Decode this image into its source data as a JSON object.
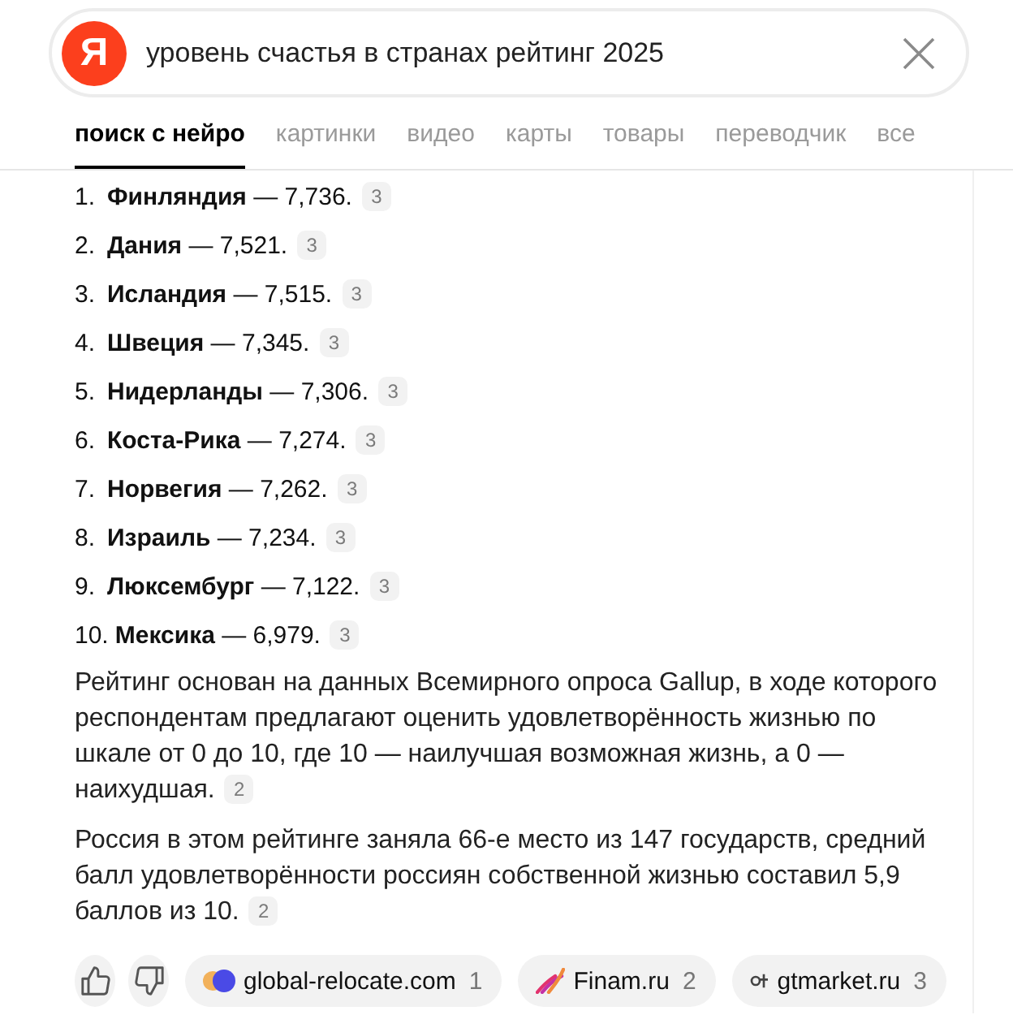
{
  "search": {
    "logo": "Я",
    "query": "уровень счастья в странах рейтинг 2025"
  },
  "tabs": [
    {
      "label": "поиск с нейро",
      "selected": true
    },
    {
      "label": "картинки",
      "selected": false
    },
    {
      "label": "видео",
      "selected": false
    },
    {
      "label": "карты",
      "selected": false
    },
    {
      "label": "товары",
      "selected": false
    },
    {
      "label": "переводчик",
      "selected": false
    },
    {
      "label": "все",
      "selected": false
    }
  ],
  "answer": {
    "list": [
      {
        "number": "1.",
        "text": "**Финляндия** — 7,736.",
        "citation": "3"
      },
      {
        "number": "2.",
        "text": "**Дания** — 7,521.",
        "citation": "3"
      },
      {
        "number": "3.",
        "text": "**Исландия** — 7,515.",
        "citation": "3"
      },
      {
        "number": "4.",
        "text": "**Швеция** — 7,345.",
        "citation": "3"
      },
      {
        "number": "5.",
        "text": "**Нидерланды** — 7,306.",
        "citation": "3"
      },
      {
        "number": "6.",
        "text": "**Коста-Рика** — 7,274.",
        "citation": "3"
      },
      {
        "number": "7.",
        "text": "**Норвегия** — 7,262.",
        "citation": "3"
      },
      {
        "number": "8.",
        "text": "**Израиль** — 7,234.",
        "citation": "3"
      },
      {
        "number": "9.",
        "text": "**Люксембург** — 7,122.",
        "citation": "3"
      },
      {
        "number": "10.",
        "text": "**Мексика** — 6,979.",
        "citation": "3"
      }
    ],
    "paragraphs": [
      {
        "text": "Рейтинг основан на данных Всемирного опроса Gallup, в ходе которого респондентам предлагают оценить удовлетворённость жизнью по шкале от 0 до 10, где 10 — наилучшая возможная жизнь, а 0 — наихудшая.",
        "citation": "2"
      },
      {
        "text": "Россия в этом рейтинге заняла 66-е место из 147 государств, средний балл удовлетворённости россиян собственной жизнью составил 5,9 баллов из 10.",
        "citation": "2"
      }
    ]
  },
  "sources": [
    {
      "kind": "circles",
      "name": "global-relocate.com",
      "count": "1"
    },
    {
      "kind": "stripes",
      "name": "Finam.ru",
      "count": "2"
    },
    {
      "kind": "ring-cross",
      "name": "gtmarket.ru",
      "count": "3"
    }
  ]
}
